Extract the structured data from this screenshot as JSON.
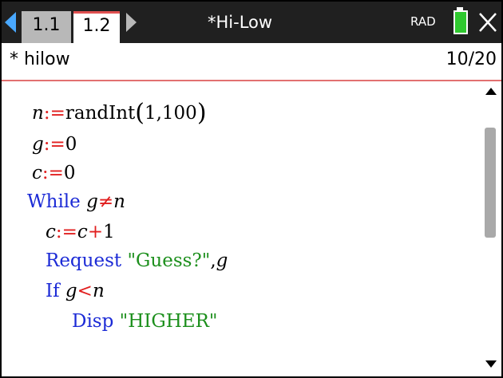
{
  "topbar": {
    "tabs": [
      {
        "label": "1.1",
        "active": false
      },
      {
        "label": "1.2",
        "active": true
      }
    ],
    "title": "*Hi-Low",
    "angle_mode": "RAD",
    "accent_color": "#49a8ff",
    "battery_color": "#2fc92f"
  },
  "subheader": {
    "program_name": "* hilow",
    "line_position": "10/20"
  },
  "code": {
    "l1": {
      "var": "n",
      "assign": ":=",
      "func": "randInt",
      "open": "(",
      "args": "1,100",
      "close": ")"
    },
    "l2": {
      "var": "g",
      "assign": ":=",
      "value": "0"
    },
    "l3": {
      "var": "c",
      "assign": ":=",
      "value": "0"
    },
    "l4": {
      "keyword": "While",
      "left": "g",
      "op": "≠",
      "right": "n"
    },
    "l5": {
      "var": "c",
      "assign": ":=",
      "expr_var": "c",
      "plus": "+",
      "value": "1"
    },
    "l6": {
      "keyword": "Request",
      "string": "\"Guess?\"",
      "sep": ",",
      "var": "g"
    },
    "l7": {
      "keyword": "If",
      "left": "g",
      "op": "<",
      "right": "n"
    },
    "l8": {
      "keyword": "Disp",
      "string": "\"HIGHER\""
    }
  }
}
